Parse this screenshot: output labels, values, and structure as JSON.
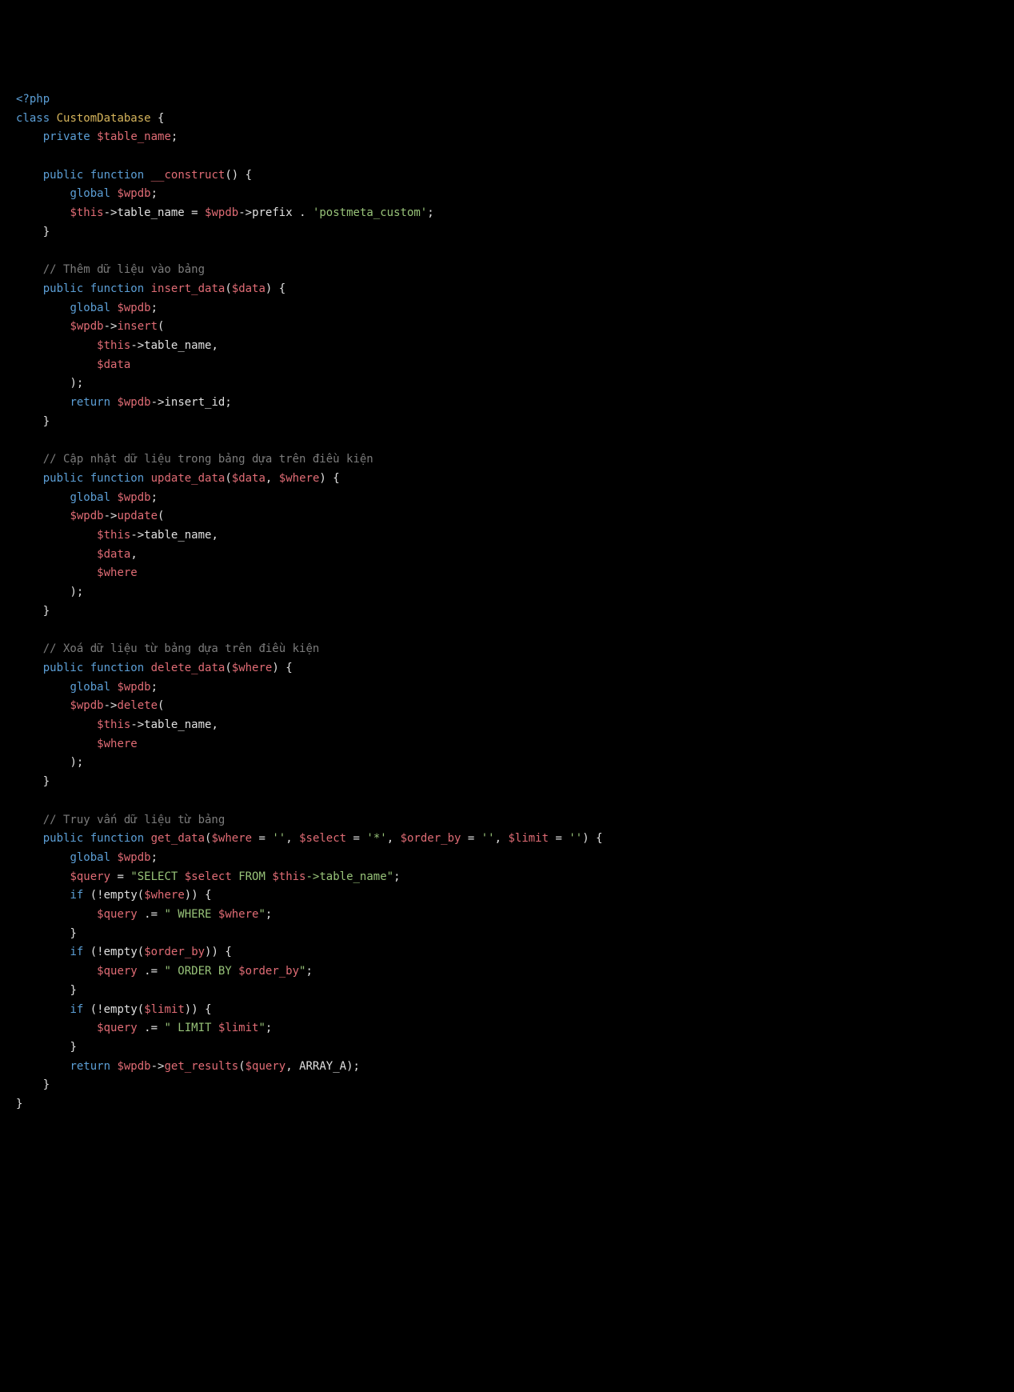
{
  "code": {
    "open_tag": "<?php",
    "class_kw": "class",
    "class_name": "CustomDatabase",
    "brace_open": " {",
    "private_kw": "private",
    "table_name_var": "$table_name",
    "semi": ";",
    "public_kw": "public",
    "function_kw": "function",
    "construct_name": "__construct",
    "empty_params": "()",
    "global_kw": "global",
    "wpdb_var": "$wpdb",
    "this_var": "$this",
    "arrow": "->",
    "table_name_prop": "table_name",
    "equals": " = ",
    "prefix_prop": "prefix",
    "concat": " . ",
    "postmeta_str": "'postmeta_custom'",
    "brace_close": "}",
    "cmt_insert": "// Thêm dữ liệu vào bảng",
    "insert_data_name": "insert_data",
    "data_param": "$data",
    "insert_method": "insert",
    "paren_open": "(",
    "paren_close": ")",
    "comma": ",",
    "return_kw": "return",
    "insert_id_prop": "insert_id",
    "cmt_update": "// Cập nhật dữ liệu trong bảng dựa trên điều kiện",
    "update_data_name": "update_data",
    "where_param": "$where",
    "update_method": "update",
    "cmt_delete": "// Xoá dữ liệu từ bảng dựa trên điều kiện",
    "delete_data_name": "delete_data",
    "delete_method": "delete",
    "cmt_get": "// Truy vấn dữ liệu từ bảng",
    "get_data_name": "get_data",
    "select_param": "$select",
    "orderby_param": "$order_by",
    "limit_param": "$limit",
    "empty_str": "''",
    "star_str": "'*'",
    "query_var": "$query",
    "select_str1": "\"SELECT ",
    "select_str2": " FROM ",
    "select_str3": "->table_name\"",
    "if_kw": "if",
    "not_empty": "!empty",
    "concat_eq": " .= ",
    "where_str1": "\" WHERE ",
    "where_str2": "\"",
    "orderby_str1": "\" ORDER BY ",
    "limit_str1": "\" LIMIT ",
    "get_results_method": "get_results",
    "array_a": "ARRAY_A"
  }
}
